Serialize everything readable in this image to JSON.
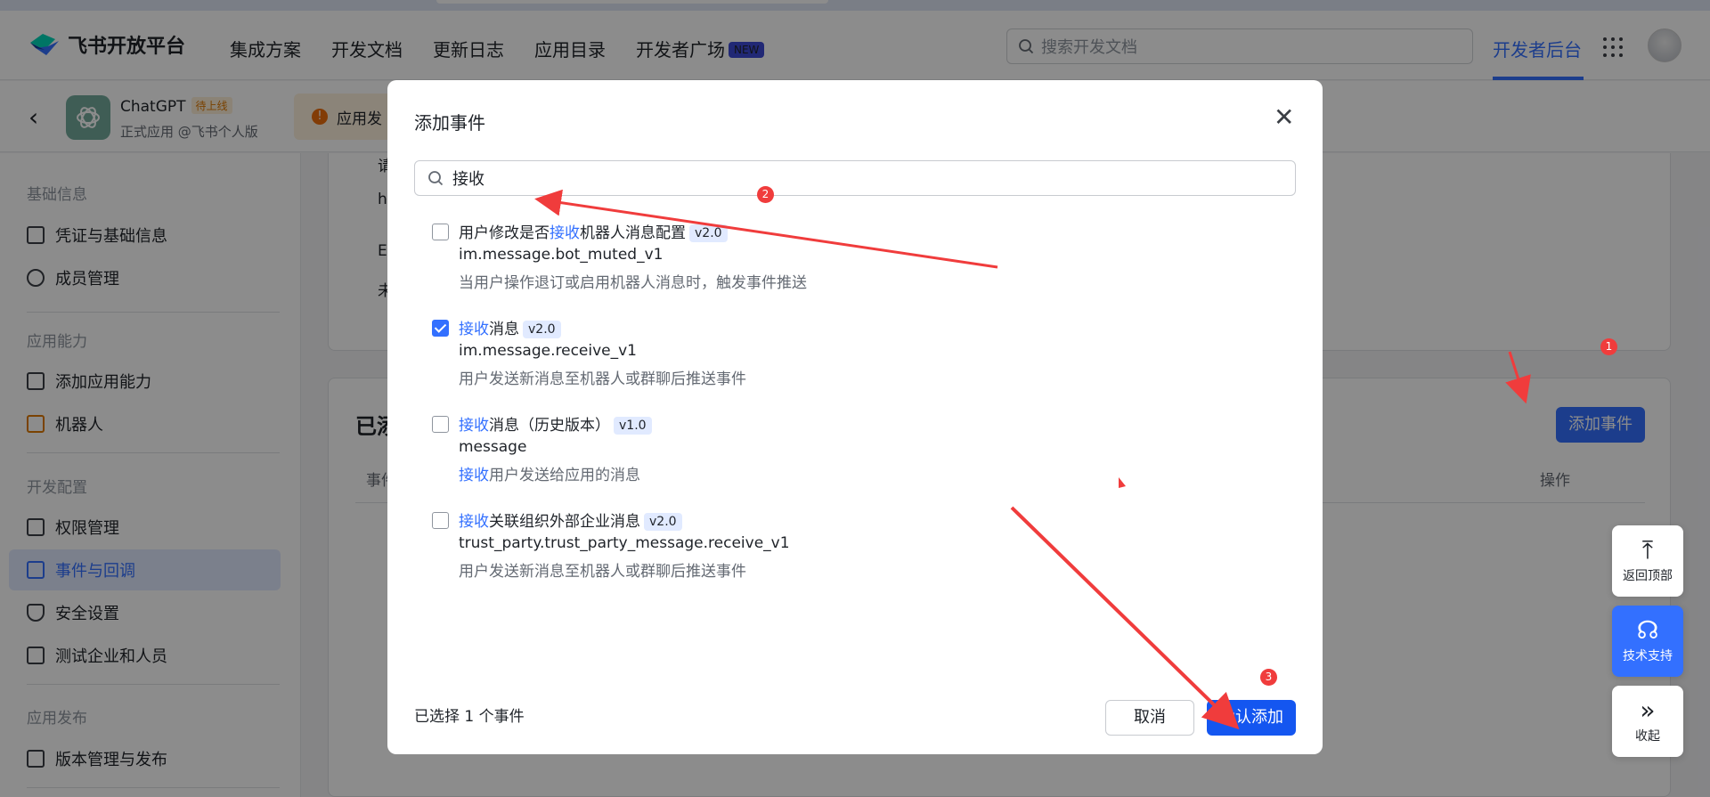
{
  "platform": {
    "title": "飞书开放平台",
    "nav": [
      "集成方案",
      "开发文档",
      "更新日志",
      "应用目录"
    ],
    "nav_highlight": "开发者广场",
    "new_badge": "NEW",
    "search_placeholder": "搜索开发文档",
    "dev_backend": "开发者后台"
  },
  "app": {
    "name": "ChatGPT",
    "status": "待上线",
    "sub": "正式应用 @飞书个人版",
    "notice": "应用发"
  },
  "sidebar": {
    "groups": [
      {
        "label": "基础信息",
        "items": [
          "凭证与基础信息",
          "成员管理"
        ]
      },
      {
        "label": "应用能力",
        "items": [
          "添加应用能力",
          "机器人"
        ]
      },
      {
        "label": "开发配置",
        "items": [
          "权限管理",
          "事件与回调",
          "安全设置",
          "测试企业和人员"
        ]
      },
      {
        "label": "应用发布",
        "items": [
          "版本管理与发布"
        ]
      }
    ],
    "active": "事件与回调"
  },
  "main": {
    "card1_lines": [
      "请",
      "h",
      "E",
      "未"
    ],
    "card2_title": "已添",
    "add_event_button": "添加事件",
    "col_event": "事件",
    "col_action": "操作"
  },
  "modal": {
    "title": "添加事件",
    "search_value": "接收",
    "events": [
      {
        "pre": "用户修改是否",
        "kw": "接收",
        "post": "机器人消息配置",
        "version": "v2.0",
        "code": "im.message.bot_muted_v1",
        "desc_kw": "",
        "desc": "当用户操作退订或启用机器人消息时，触发事件推送",
        "checked": false
      },
      {
        "pre": "",
        "kw": "接收",
        "post": "消息",
        "version": "v2.0",
        "code": "im.message.receive_v1",
        "desc_kw": "",
        "desc": "用户发送新消息至机器人或群聊后推送事件",
        "checked": true
      },
      {
        "pre": "",
        "kw": "接收",
        "post": "消息（历史版本）",
        "version": "v1.0",
        "code": "message",
        "desc_kw": "接收",
        "desc": "用户发送给应用的消息",
        "checked": false
      },
      {
        "pre": "",
        "kw": "接收",
        "post": "关联组织外部企业消息",
        "version": "v2.0",
        "code": "trust_party.trust_party_message.receive_v1",
        "desc_kw": "",
        "desc": "用户发送新消息至机器人或群聊后推送事件",
        "checked": false
      }
    ],
    "selected_count": "已选择 1 个事件",
    "cancel": "取消",
    "confirm": "确认添加"
  },
  "float": {
    "top": "返回顶部",
    "support": "技术支持",
    "collapse": "收起"
  },
  "annotations": [
    "1",
    "2",
    "3"
  ],
  "colors": {
    "accent": "#3370ff",
    "annot": "#f03c3c"
  }
}
